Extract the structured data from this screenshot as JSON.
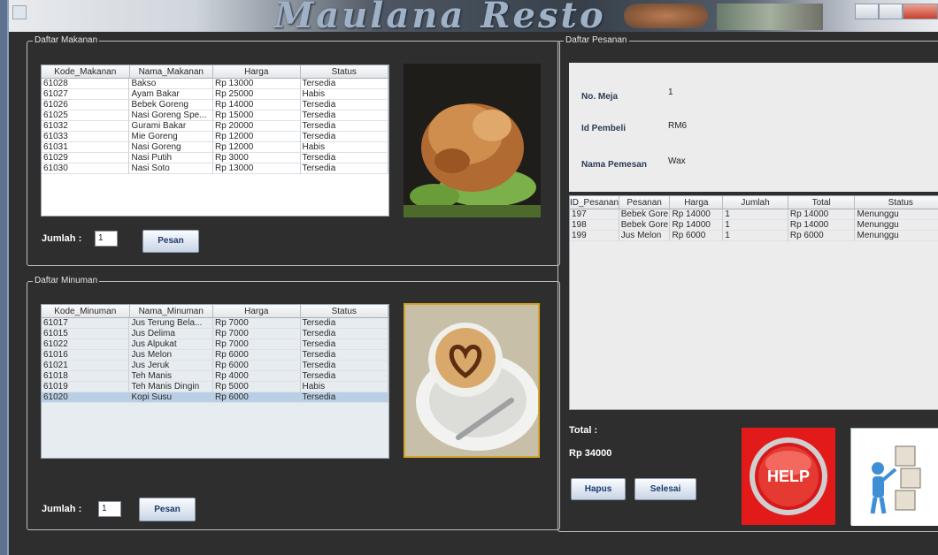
{
  "window": {
    "banner_title": "Maulana Resto"
  },
  "makanan": {
    "legend": "Daftar Makanan",
    "columns": [
      "Kode_Makanan",
      "Nama_Makanan",
      "Harga",
      "Status"
    ],
    "rows": [
      [
        "61028",
        "Bakso",
        "Rp 13000",
        "Tersedia"
      ],
      [
        "61027",
        "Ayam Bakar",
        "Rp 25000",
        "Habis"
      ],
      [
        "61026",
        "Bebek Goreng",
        "Rp 14000",
        "Tersedia"
      ],
      [
        "61025",
        "Nasi Goreng Spe...",
        "Rp 15000",
        "Tersedia"
      ],
      [
        "61032",
        "Gurami Bakar",
        "Rp 20000",
        "Tersedia"
      ],
      [
        "61033",
        "Mie Goreng",
        "Rp 12000",
        "Tersedia"
      ],
      [
        "61031",
        "Nasi Goreng",
        "Rp 12000",
        "Habis"
      ],
      [
        "61029",
        "Nasi Putih",
        "Rp 3000",
        "Tersedia"
      ],
      [
        "61030",
        "Nasi Soto",
        "Rp 13000",
        "Tersedia"
      ]
    ],
    "jumlah_label": "Jumlah :",
    "jumlah_value": "1",
    "pesan_label": "Pesan"
  },
  "minuman": {
    "legend": "Daftar Minuman",
    "columns": [
      "Kode_Minuman",
      "Nama_Minuman",
      "Harga",
      "Status"
    ],
    "rows": [
      [
        "61017",
        "Jus Terung Bela...",
        "Rp 7000",
        "Tersedia"
      ],
      [
        "61015",
        "Jus Delima",
        "Rp 7000",
        "Tersedia"
      ],
      [
        "61022",
        "Jus Alpukat",
        "Rp 7000",
        "Tersedia"
      ],
      [
        "61016",
        "Jus Melon",
        "Rp 6000",
        "Tersedia"
      ],
      [
        "61021",
        "Jus Jeruk",
        "Rp 6000",
        "Tersedia"
      ],
      [
        "61018",
        "Teh Manis",
        "Rp 4000",
        "Tersedia"
      ],
      [
        "61019",
        "Teh Manis Dingin",
        "Rp 5000",
        "Habis"
      ],
      [
        "61020",
        "Kopi Susu",
        "Rp 6000",
        "Tersedia"
      ]
    ],
    "jumlah_label": "Jumlah :",
    "jumlah_value": "1",
    "pesan_label": "Pesan"
  },
  "pesanan": {
    "legend": "Daftar Pesanan",
    "no_meja_label": "No. Meja",
    "no_meja_value": "1",
    "id_pembeli_label": "Id Pembeli",
    "id_pembeli_value": "RM6",
    "nama_label": "Nama Pemesan",
    "nama_value": "Wax",
    "columns": [
      "ID_Pesanan",
      "Pesanan",
      "Harga",
      "Jumlah",
      "Total",
      "Status"
    ],
    "rows": [
      [
        "197",
        "Bebek Gore...",
        "Rp 14000",
        "1",
        "Rp 14000",
        "Menunggu"
      ],
      [
        "198",
        "Bebek Gore...",
        "Rp 14000",
        "1",
        "Rp 14000",
        "Menunggu"
      ],
      [
        "199",
        "Jus Melon",
        "Rp 6000",
        "1",
        "Rp 6000",
        "Menunggu"
      ]
    ],
    "total_label": "Total :",
    "total_value": "Rp 34000",
    "hapus_label": "Hapus",
    "selesai_label": "Selesai",
    "help_label": "HELP"
  }
}
